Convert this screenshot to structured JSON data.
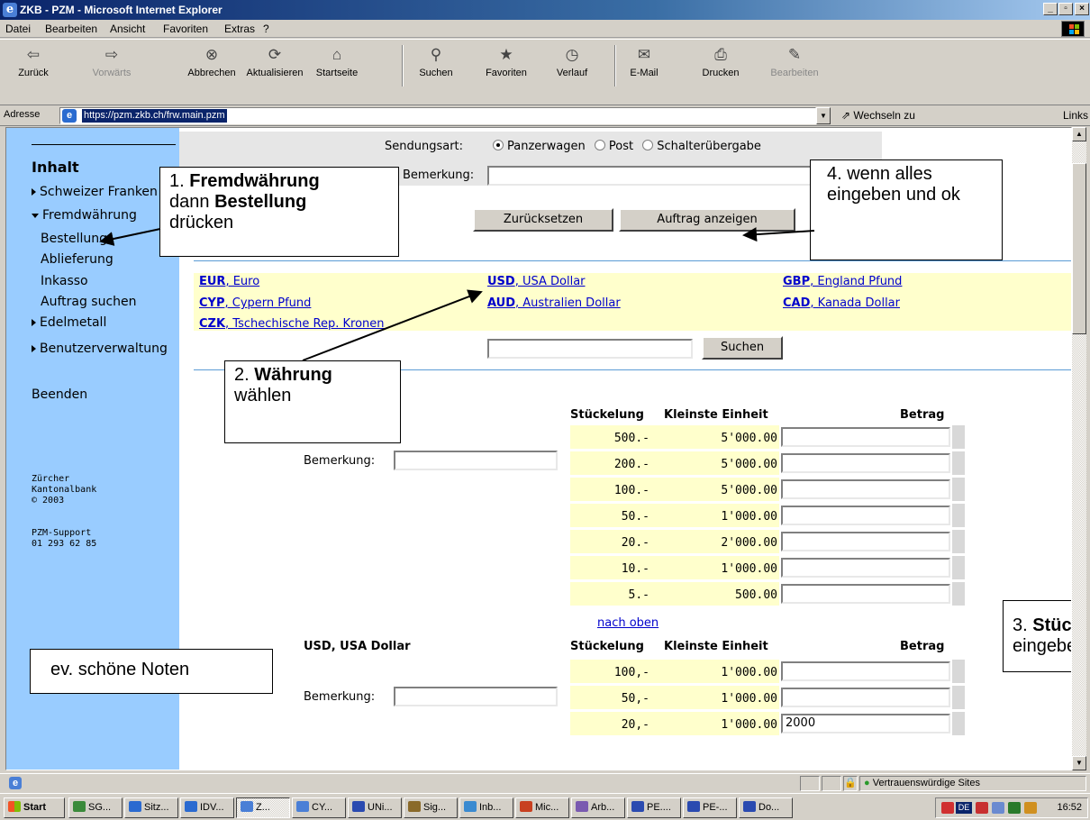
{
  "window": {
    "title": "ZKB - PZM - Microsoft Internet Explorer"
  },
  "menu": [
    "Datei",
    "Bearbeiten",
    "Ansicht",
    "Favoriten",
    "Extras",
    "?"
  ],
  "toolbar": {
    "back": "Zurück",
    "forward": "Vorwärts",
    "stop": "Abbrechen",
    "refresh": "Aktualisieren",
    "home": "Startseite",
    "search": "Suchen",
    "favorites": "Favoriten",
    "history": "Verlauf",
    "mail": "E-Mail",
    "print": "Drucken",
    "edit": "Bearbeiten"
  },
  "address": {
    "label": "Adresse",
    "url": "https://pzm.zkb.ch/frw.main.pzm",
    "go": "Wechseln zu",
    "links": "Links"
  },
  "sidebar": {
    "title": "Inhalt",
    "items": [
      "Schweizer Franken",
      "Fremdwährung",
      "Bestellung",
      "Ablieferung",
      "Inkasso",
      "Auftrag suchen",
      "Edelmetall",
      "Benutzerverwaltung"
    ],
    "logout": "Beenden",
    "bank": "Zürcher\nKantonalbank\n© 2003",
    "support": "PZM-Support\n01 293 62 85"
  },
  "form": {
    "sendungsart_label": "Sendungsart:",
    "options": [
      "Panzerwagen",
      "Post",
      "Schalterübergabe"
    ],
    "bemerkung_label": "Bemerkung:",
    "reset": "Zurücksetzen",
    "show_order": "Auftrag anzeigen",
    "search_button": "Suchen"
  },
  "currencies": [
    {
      "code": "EUR",
      "name": ", Euro"
    },
    {
      "code": "USD",
      "name": ", USA Dollar"
    },
    {
      "code": "GBP",
      "name": ", England Pfund"
    },
    {
      "code": "CYP",
      "name": ", Cypern Pfund"
    },
    {
      "code": "AUD",
      "name": ", Australien Dollar"
    },
    {
      "code": "CAD",
      "name": ", Kanada Dollar"
    },
    {
      "code": "CZK",
      "name": ", Tschechische Rep. Kronen"
    }
  ],
  "table_headers": {
    "stueckelung": "Stückelung",
    "kleinste": "Kleinste Einheit",
    "betrag": "Betrag"
  },
  "block1": {
    "bemerkung": "Bemerkung:",
    "rows": [
      {
        "denom": "500.-",
        "min": "5'000.00",
        "amount": ""
      },
      {
        "denom": "200.-",
        "min": "5'000.00",
        "amount": ""
      },
      {
        "denom": "100.-",
        "min": "5'000.00",
        "amount": ""
      },
      {
        "denom": "50.-",
        "min": "1'000.00",
        "amount": ""
      },
      {
        "denom": "20.-",
        "min": "2'000.00",
        "amount": ""
      },
      {
        "denom": "10.-",
        "min": "1'000.00",
        "amount": ""
      },
      {
        "denom": "5.-",
        "min": "500.00",
        "amount": ""
      }
    ]
  },
  "nach_oben": "nach oben",
  "block2": {
    "title": "USD, USA Dollar",
    "bemerkung": "Bemerkung:",
    "rows": [
      {
        "denom": "100,-",
        "min": "1'000.00",
        "amount": ""
      },
      {
        "denom": "50,-",
        "min": "1'000.00",
        "amount": ""
      },
      {
        "denom": "20,-",
        "min": "1'000.00",
        "amount": "2000"
      }
    ]
  },
  "callouts": {
    "c1a": "1. ",
    "c1b": "Fremdwährung",
    "c1c": "dann ",
    "c1d": "Bestellung",
    "c1e": "drücken",
    "c2a": "2. ",
    "c2b": "Währung",
    "c2c": "wählen",
    "c3a": "3. ",
    "c3b": "Stüc",
    "c3c": "eingebe",
    "c4": "4. wenn alles eingeben und ok",
    "c5": "ev. schöne Noten"
  },
  "status": {
    "zone": "Vertrauenswürdige Sites"
  },
  "taskbar": {
    "start": "Start",
    "tasks": [
      "SG...",
      "Sitz...",
      "IDV...",
      "Z...",
      "CY...",
      "UNi...",
      "Sig...",
      "Inb...",
      "Mic...",
      "Arb...",
      "PE....",
      "PE-...",
      "Do..."
    ],
    "clock": "16:52"
  }
}
